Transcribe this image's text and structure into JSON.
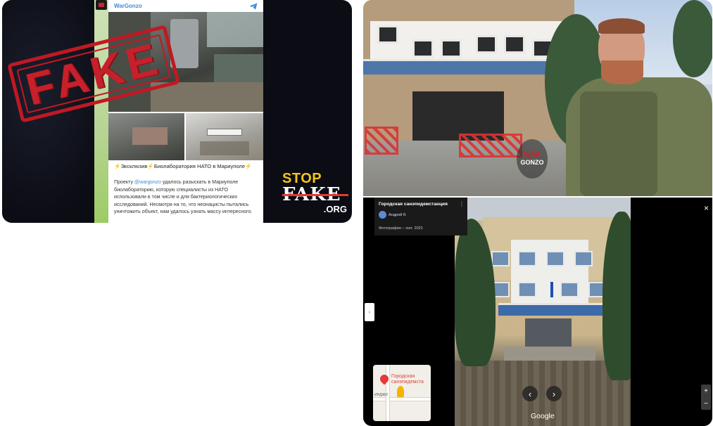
{
  "left_panel": {
    "stamp_text": "FAKE",
    "telegram": {
      "channel_name": "WarGonzo",
      "headline": "⚡Эксклюзив⚡Биолаборатория НАТО в Мариуполе⚡",
      "body_prefix": "Проекту ",
      "body_link": "@wargonzo",
      "body_rest": " удалось разыскать в Мариуполе биолабораторию, которую специалисты из НАТО использовали в том числе и для бактериологических исследований. Несмотря на то, что неонацисты пытались уничтожить объект, нам удалось узнать массу интересного."
    },
    "logo": {
      "stop": "STOP",
      "fake": "FAKE",
      "org": ".ORG"
    }
  },
  "right_top": {
    "watermark_line1": "WAR",
    "watermark_line2": "GONZO"
  },
  "right_bottom": {
    "place_title": "Городская санэпидемстанция",
    "user_name": "Андрей Б",
    "photo_date": "Фотография – лют. 2021",
    "google_label": "Google",
    "close_icon": "×",
    "collapse_icon": "‹",
    "arrow_left": "‹",
    "arrow_right": "›",
    "zoom_in": "+",
    "zoom_out": "−",
    "more_icon": "⋮",
    "minimap": {
      "label": "Городская санэпидемста",
      "street": "ИНДЖИ"
    }
  },
  "colors": {
    "stamp_red": "#c01923",
    "telegram_blue": "#3a8bd6",
    "stopfake_yellow": "#f5c518"
  }
}
